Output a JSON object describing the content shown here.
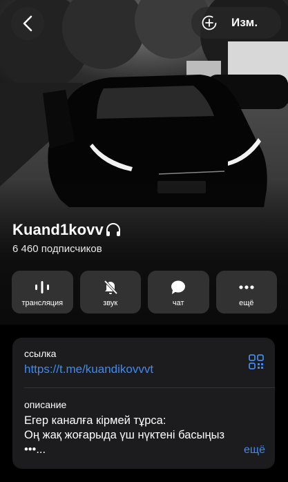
{
  "header": {
    "edit_label": "Изм."
  },
  "channel": {
    "name": "Kuand1kovv",
    "subscribers": "6 460 подписчиков"
  },
  "actions": [
    {
      "label": "трансляция",
      "icon": "broadcast-icon"
    },
    {
      "label": "звук",
      "icon": "bell-slash-icon"
    },
    {
      "label": "чат",
      "icon": "chat-bubble-icon"
    },
    {
      "label": "ещё",
      "icon": "more-dots-icon"
    }
  ],
  "info": {
    "link_label": "ссылка",
    "link": "https://t.me/kuandikovvvt",
    "description_label": "описание",
    "description_line1": "Егер каналға кірмей тұрса:",
    "description_line2": "Оң жақ жоғарыда үш нүктені басыңыз",
    "description_line3": "•••...",
    "more_label": "ещё"
  },
  "colors": {
    "accent": "#3e8bf0",
    "card_bg": "#1c1c1e",
    "button_bg": "#3a3a3a"
  }
}
